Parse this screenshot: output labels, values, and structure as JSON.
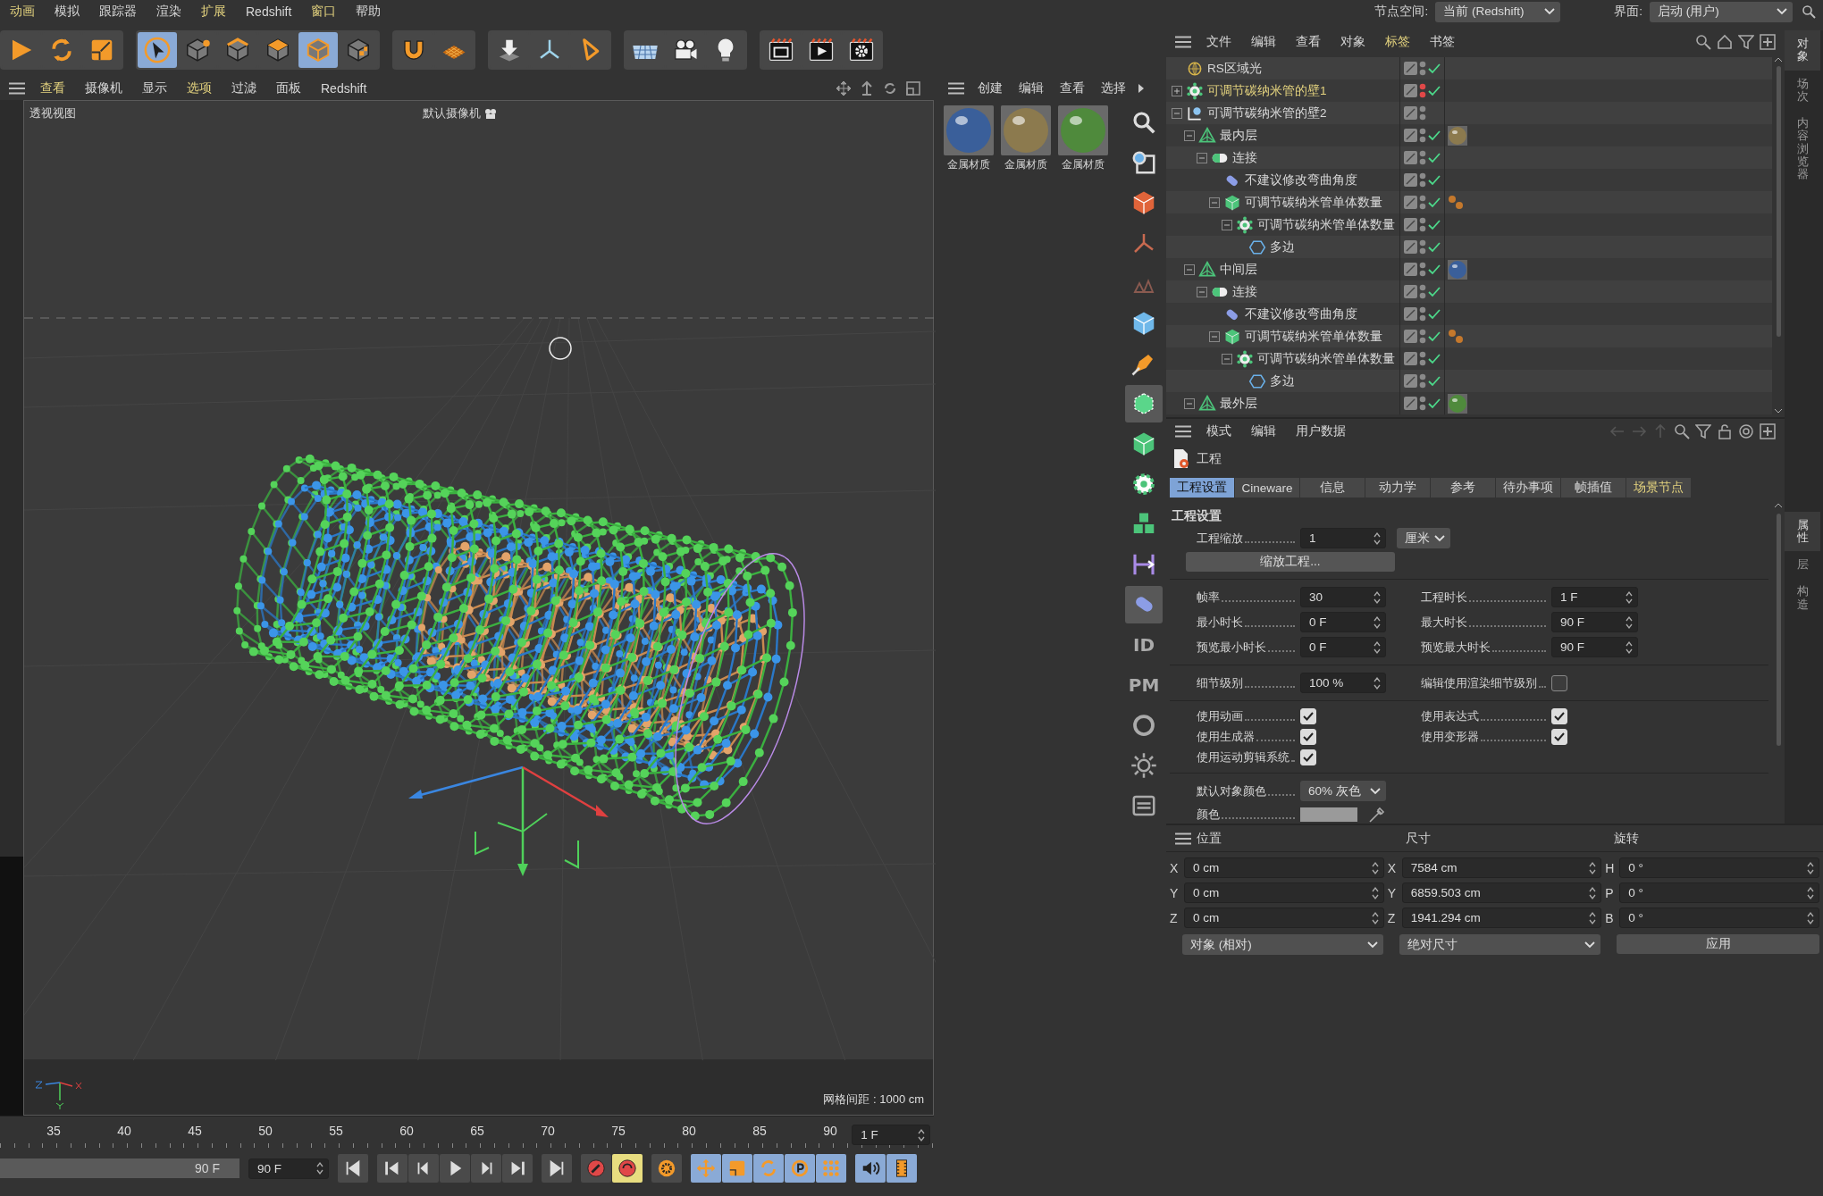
{
  "menubar": {
    "items": [
      {
        "label": "动画",
        "highlighted": true
      },
      {
        "label": "模拟",
        "highlighted": false
      },
      {
        "label": "跟踪器",
        "highlighted": false
      },
      {
        "label": "渲染",
        "highlighted": false
      },
      {
        "label": "扩展",
        "highlighted": true
      },
      {
        "label": "Redshift",
        "highlighted": false
      },
      {
        "label": "窗口",
        "highlighted": true
      },
      {
        "label": "帮助",
        "highlighted": false
      }
    ],
    "node_space": {
      "label": "节点空间:",
      "value": "当前 (Redshift)"
    },
    "layout": {
      "label": "界面:",
      "value": "启动 (用户)"
    }
  },
  "toolbar": [
    [
      {
        "kind": "play",
        "selected": false
      },
      {
        "kind": "rotate",
        "selected": false
      },
      {
        "kind": "scale",
        "selected": false
      }
    ],
    [
      {
        "kind": "select",
        "selected": true
      },
      {
        "kind": "points",
        "selected": false
      },
      {
        "kind": "edges",
        "selected": false
      },
      {
        "kind": "polygons",
        "selected": false
      },
      {
        "kind": "model",
        "selected": true
      },
      {
        "kind": "texture",
        "selected": false
      }
    ],
    [
      {
        "kind": "magnet",
        "selected": false
      },
      {
        "kind": "workplane",
        "selected": false
      }
    ],
    [
      {
        "kind": "drop",
        "selected": false
      },
      {
        "kind": "axis",
        "selected": false
      },
      {
        "kind": "pen",
        "selected": false
      }
    ],
    [
      {
        "kind": "floor",
        "selected": false
      },
      {
        "kind": "camera",
        "selected": false
      },
      {
        "kind": "light",
        "selected": false
      }
    ],
    [
      {
        "kind": "render_view",
        "selected": false
      },
      {
        "kind": "render",
        "selected": false
      },
      {
        "kind": "render_settings",
        "selected": false
      }
    ]
  ],
  "viewport": {
    "menu": [
      {
        "label": "查看",
        "highlighted": true
      },
      {
        "label": "摄像机",
        "highlighted": false
      },
      {
        "label": "显示",
        "highlighted": false
      },
      {
        "label": "选项",
        "highlighted": true
      },
      {
        "label": "过滤",
        "highlighted": false
      },
      {
        "label": "面板",
        "highlighted": false
      },
      {
        "label": "Redshift",
        "highlighted": false
      }
    ],
    "view_name": "透视视图",
    "camera": "默认摄像机",
    "grid_spacing": "网格间距 : 1000 cm"
  },
  "timeline": {
    "ticks": [
      "35",
      "40",
      "45",
      "50",
      "55",
      "60",
      "65",
      "70",
      "75",
      "80",
      "85",
      "90"
    ],
    "current_frame": "1 F",
    "range": {
      "label": "90 F",
      "level": 1
    },
    "end_frame": "90 F",
    "controls": [
      {
        "kind": "first",
        "on": false
      },
      {
        "kind": "prev_key",
        "on": false
      },
      {
        "kind": "prev_frame",
        "on": false
      },
      {
        "kind": "play",
        "on": false
      },
      {
        "kind": "next_frame",
        "on": false
      },
      {
        "kind": "next_key",
        "on": false
      },
      {
        "kind": "last",
        "on": false
      },
      {
        "kind": "record",
        "on": false
      },
      {
        "kind": "autokey",
        "on": true
      },
      {
        "kind": "key_settings",
        "on": false
      },
      {
        "kind": "move",
        "on": true
      },
      {
        "kind": "scale",
        "on": true
      },
      {
        "kind": "rotate",
        "on": true
      },
      {
        "kind": "param",
        "on": true
      },
      {
        "kind": "points",
        "on": true
      },
      {
        "kind": "sound",
        "on": true
      },
      {
        "kind": "film",
        "on": true
      }
    ]
  },
  "materials": {
    "menu": [
      "创建",
      "编辑",
      "查看",
      "选择"
    ],
    "items": [
      {
        "name": "金属材质",
        "color": "#3a5f9a"
      },
      {
        "name": "金属材质",
        "color": "#8c7a4e"
      },
      {
        "name": "金属材质",
        "color": "#4f8a3c"
      }
    ]
  },
  "side_tools": [
    {
      "kind": "zoom",
      "selected": false
    },
    {
      "kind": "select_rect",
      "selected": false
    },
    {
      "kind": "box",
      "selected": false
    },
    {
      "kind": "joint",
      "selected": false
    },
    {
      "kind": "ik",
      "selected": false
    },
    {
      "kind": "cube",
      "selected": false
    },
    {
      "kind": "pen",
      "selected": false
    },
    {
      "kind": "spline_cube",
      "selected": true
    },
    {
      "kind": "green_cube",
      "selected": false
    },
    {
      "kind": "cloner",
      "selected": false
    },
    {
      "kind": "cubes",
      "selected": false
    },
    {
      "kind": "ruler",
      "selected": false
    },
    {
      "kind": "bend",
      "selected": true
    },
    {
      "kind": "text",
      "label": "ID",
      "selected": false
    },
    {
      "kind": "text",
      "label": "PM",
      "selected": false
    },
    {
      "kind": "ring",
      "selected": false
    },
    {
      "kind": "sun",
      "selected": false
    },
    {
      "kind": "badge",
      "selected": false
    }
  ],
  "objects": {
    "menu": [
      {
        "label": "文件",
        "highlighted": false
      },
      {
        "label": "编辑",
        "highlighted": false
      },
      {
        "label": "查看",
        "highlighted": false
      },
      {
        "label": "对象",
        "highlighted": false
      },
      {
        "label": "标签",
        "highlighted": true
      },
      {
        "label": "书签",
        "highlighted": false
      }
    ],
    "tree": [
      {
        "name": "RS区域光",
        "kind": "light",
        "highlighted": false,
        "enabled": true,
        "hidden": false
      },
      {
        "name": "可调节碳纳米管的壁1",
        "kind": "cloner",
        "highlighted": true,
        "expanded": false,
        "enabled": true,
        "hidden": true
      },
      {
        "name": "可调节碳纳米管的壁2",
        "kind": "null",
        "highlighted": false,
        "expanded": true,
        "enabled": false,
        "hidden": false,
        "children": [
          {
            "name": "最内层",
            "kind": "layer",
            "highlighted": false,
            "expanded": true,
            "enabled": true,
            "hidden": false,
            "tag": {
              "kind": "material",
              "color": "#8c7a4e"
            },
            "children": [
              {
                "name": "连接",
                "kind": "connect",
                "highlighted": false,
                "expanded": true,
                "enabled": true,
                "hidden": false,
                "children": [
                  {
                    "name": "不建议修改弯曲角度",
                    "kind": "bend",
                    "highlighted": false,
                    "enabled": true,
                    "hidden": false
                  },
                  {
                    "name": "可调节碳纳米管单体数量",
                    "kind": "cube",
                    "highlighted": false,
                    "expanded": true,
                    "enabled": true,
                    "hidden": false,
                    "tag": {
                      "kind": "dots"
                    },
                    "children": [
                      {
                        "name": "可调节碳纳米管单体数量",
                        "kind": "cloner",
                        "highlighted": false,
                        "expanded": true,
                        "enabled": true,
                        "hidden": false,
                        "children": [
                          {
                            "name": "多边",
                            "kind": "polygon",
                            "highlighted": false,
                            "enabled": true,
                            "hidden": false
                          }
                        ]
                      }
                    ]
                  }
                ]
              }
            ]
          },
          {
            "name": "中间层",
            "kind": "layer",
            "highlighted": false,
            "expanded": true,
            "enabled": true,
            "hidden": false,
            "tag": {
              "kind": "material",
              "color": "#3a5f9a"
            },
            "children": [
              {
                "name": "连接",
                "kind": "connect",
                "highlighted": false,
                "expanded": true,
                "enabled": true,
                "hidden": false,
                "children": [
                  {
                    "name": "不建议修改弯曲角度",
                    "kind": "bend",
                    "highlighted": false,
                    "enabled": true,
                    "hidden": false
                  },
                  {
                    "name": "可调节碳纳米管单体数量",
                    "kind": "cube",
                    "highlighted": false,
                    "expanded": true,
                    "enabled": true,
                    "hidden": false,
                    "tag": {
                      "kind": "dots"
                    },
                    "children": [
                      {
                        "name": "可调节碳纳米管单体数量",
                        "kind": "cloner",
                        "highlighted": false,
                        "expanded": true,
                        "enabled": true,
                        "hidden": false,
                        "children": [
                          {
                            "name": "多边",
                            "kind": "polygon",
                            "highlighted": false,
                            "enabled": true,
                            "hidden": false
                          }
                        ]
                      }
                    ]
                  }
                ]
              }
            ]
          },
          {
            "name": "最外层",
            "kind": "layer",
            "highlighted": false,
            "expanded": true,
            "enabled": true,
            "hidden": false,
            "tag": {
              "kind": "material",
              "color": "#4f8a3c"
            }
          }
        ]
      }
    ]
  },
  "attributes": {
    "menu": [
      "模式",
      "编辑",
      "用户数据"
    ],
    "title": "工程",
    "tabs": [
      {
        "label": "工程设置",
        "selected": true,
        "highlighted": false
      },
      {
        "label": "Cineware",
        "selected": false,
        "highlighted": false
      },
      {
        "label": "信息",
        "selected": false,
        "highlighted": false
      },
      {
        "label": "动力学",
        "selected": false,
        "highlighted": false
      },
      {
        "label": "参考",
        "selected": false,
        "highlighted": false
      },
      {
        "label": "待办事项",
        "selected": false,
        "highlighted": false
      },
      {
        "label": "帧插值",
        "selected": false,
        "highlighted": false
      },
      {
        "label": "场景节点",
        "selected": false,
        "highlighted": true
      }
    ],
    "section": "工程设置",
    "scale": {
      "label": "工程缩放",
      "value": "1",
      "unit": "厘米"
    },
    "scale_button": "缩放工程...",
    "time_fields": [
      {
        "label": "帧率",
        "value": "30"
      },
      {
        "label": "工程时长",
        "value": "1 F"
      },
      {
        "label": "最小时长",
        "value": "0 F"
      },
      {
        "label": "最大时长",
        "value": "90 F"
      },
      {
        "label": "预览最小时长",
        "value": "0 F"
      },
      {
        "label": "预览最大时长",
        "value": "90 F"
      }
    ],
    "detail": {
      "label": "细节级别",
      "value": "100 %"
    },
    "render_detail": {
      "label": "编辑使用渲染细节级别",
      "checked": false
    },
    "options": [
      {
        "label": "使用动画",
        "checked": true
      },
      {
        "label": "使用表达式",
        "checked": true
      },
      {
        "label": "使用生成器",
        "checked": true
      },
      {
        "label": "使用变形器",
        "checked": true
      },
      {
        "label": "使用运动剪辑系统",
        "checked": true
      }
    ],
    "default_color": {
      "label": "默认对象颜色",
      "value": "60% 灰色"
    },
    "color": {
      "label": "颜色",
      "color": "#9a9a9a"
    }
  },
  "coordinates": {
    "headers": [
      "位置",
      "尺寸",
      "旋转"
    ],
    "rows": [
      [
        {
          "axis": "X",
          "value": "0 cm"
        },
        {
          "axis": "X",
          "value": "7584 cm"
        },
        {
          "axis": "H",
          "value": "0 °"
        }
      ],
      [
        {
          "axis": "Y",
          "value": "0 cm"
        },
        {
          "axis": "Y",
          "value": "6859.503 cm"
        },
        {
          "axis": "P",
          "value": "0 °"
        }
      ],
      [
        {
          "axis": "Z",
          "value": "0 cm"
        },
        {
          "axis": "Z",
          "value": "1941.294 cm"
        },
        {
          "axis": "B",
          "value": "0 °"
        }
      ]
    ],
    "mode": "对象 (相对)",
    "size_mode": "绝对尺寸",
    "apply": "应用"
  },
  "side_tabs": {
    "top": [
      {
        "label": "对象",
        "selected": true
      },
      {
        "label": "场次",
        "selected": false
      },
      {
        "label": "内容浏览器",
        "selected": false
      }
    ],
    "bottom": [
      {
        "label": "属性",
        "selected": true
      },
      {
        "label": "层",
        "selected": false
      },
      {
        "label": "构造",
        "selected": false
      }
    ]
  }
}
